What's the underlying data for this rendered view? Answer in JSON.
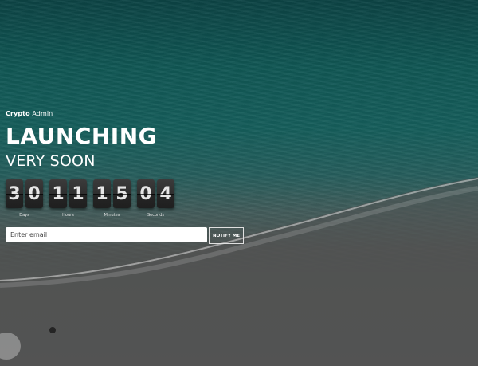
{
  "brand": {
    "bold": "Crypto",
    "rest": " Admin"
  },
  "hero": {
    "title": "LAUNCHING",
    "subtitle": "VERY SOON"
  },
  "countdown": [
    {
      "digits": [
        "3",
        "0"
      ],
      "label": "Days"
    },
    {
      "digits": [
        "1",
        "1"
      ],
      "label": "Hours"
    },
    {
      "digits": [
        "1",
        "5"
      ],
      "label": "Minutes"
    },
    {
      "digits": [
        "0",
        "4"
      ],
      "label": "Seconds"
    }
  ],
  "subscribe": {
    "placeholder": "Enter email",
    "button_label": "NOTIFY ME"
  },
  "colors": {
    "sea": "#156562",
    "sand": "#5f5f5f",
    "digit_bg": "#2f2f2f",
    "text": "#ffffff"
  }
}
